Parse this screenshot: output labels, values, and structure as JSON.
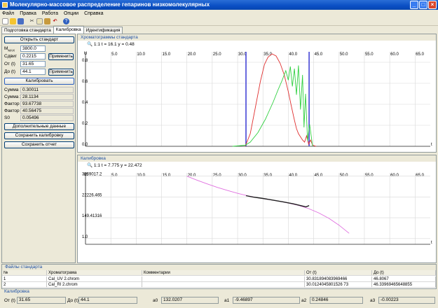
{
  "window": {
    "title": "Молекулярно-массовое распределение гепаринов низкомолекулярных",
    "buttons": [
      "_",
      "□",
      "×"
    ]
  },
  "menu": [
    "Файл",
    "Правка",
    "Работа",
    "Опции",
    "Справка"
  ],
  "toolbar_icons": [
    "new-icon",
    "open-icon",
    "save-icon",
    "cut-icon",
    "copy-icon",
    "paste-icon",
    "undo-icon",
    "help-icon"
  ],
  "tabs": [
    {
      "label": "Подготовка стандарта",
      "active": false
    },
    {
      "label": "Калибровка",
      "active": true
    },
    {
      "label": "Идентификация",
      "active": false
    }
  ],
  "left": {
    "open_standard": "Открыть стандарт",
    "mw_label": "M",
    "mw_sub": "MAX",
    "mw_value": "3800.0",
    "shift_label": "Сдвиг",
    "shift_value": "0.2215",
    "apply1": "Применить",
    "from_label": "От (t)",
    "from_value": "31.65",
    "to_label": "До (t)",
    "to_value": "44.1",
    "apply2": "Применить",
    "calibrate": "Калибровать",
    "stats": [
      {
        "label": "Сумма 1",
        "value": "0.30011"
      },
      {
        "label": "Сумма 2",
        "value": "28.1134"
      },
      {
        "label": "Фактор r",
        "value": "93.67738"
      },
      {
        "label": "Фактор f",
        "value": "40.56475"
      },
      {
        "label": "S0",
        "value": "0.05496"
      }
    ],
    "extra_data": "Дополнительные данные",
    "save_calibration": "Сохранить калибровку",
    "save_report": "Сохранить отчет"
  },
  "chart1": {
    "pane_title": "Хроматограммы стандарта",
    "toolbar_text": "1:1  t = 16.1  y = 0.48",
    "x_ticks": [
      "5.0",
      "10.0",
      "15.0",
      "20.0",
      "25.0",
      "30.0",
      "35.0",
      "40.0",
      "45.0",
      "50.0",
      "55.0",
      "60.0",
      "65.0"
    ],
    "y_ticks": [
      "0.8",
      "0.6",
      "0.4",
      "0.2",
      "0.0"
    ],
    "x_axis_label": "t",
    "y_axis_label": "U"
  },
  "chart2": {
    "pane_title": "Калибровка",
    "toolbar_text": "1:1  t = 7.775  y = 22.472",
    "x_ticks": [
      "5.0",
      "10.0",
      "15.0",
      "20.0",
      "25.0",
      "30.0",
      "35.0",
      "40.0",
      "45.0",
      "50.0",
      "55.0",
      "60.0",
      "65.0"
    ],
    "y_ticks": [
      "3269017.2",
      "22226.465",
      "149.41316",
      "1.0"
    ],
    "x_axis_label": "t",
    "y_axis_label": "M"
  },
  "chart_data": [
    {
      "type": "line",
      "title": "Хроматограммы стандарта",
      "xlabel": "t",
      "ylabel": "U",
      "xlim": [
        0,
        68
      ],
      "ylim": [
        0,
        0.9
      ],
      "vlines": [
        31.65,
        44.1
      ],
      "series": [
        {
          "color": "#e03030",
          "points": [
            [
              31.5,
              0.0
            ],
            [
              32.5,
              0.12
            ],
            [
              33.5,
              0.37
            ],
            [
              34.5,
              0.62
            ],
            [
              35.3,
              0.78
            ],
            [
              36.0,
              0.85
            ],
            [
              36.8,
              0.88
            ],
            [
              37.6,
              0.86
            ],
            [
              38.4,
              0.79
            ],
            [
              39.2,
              0.68
            ],
            [
              40.0,
              0.52
            ],
            [
              40.6,
              0.38
            ],
            [
              41.2,
              0.25
            ],
            [
              41.6,
              0.17
            ],
            [
              42.0,
              0.12
            ],
            [
              42.4,
              0.09
            ],
            [
              42.8,
              0.06
            ],
            [
              43.2,
              0.04
            ],
            [
              43.6,
              0.1
            ],
            [
              44.0,
              0.02
            ],
            [
              44.4,
              0.06
            ],
            [
              44.8,
              0.01
            ],
            [
              45.5,
              0.0
            ]
          ]
        },
        {
          "color": "#30d040",
          "points": [
            [
              29.0,
              0.0
            ],
            [
              31.5,
              0.01
            ],
            [
              32.5,
              0.04
            ],
            [
              34.0,
              0.13
            ],
            [
              35.5,
              0.26
            ],
            [
              37.0,
              0.42
            ],
            [
              38.0,
              0.54
            ],
            [
              38.8,
              0.63
            ],
            [
              39.5,
              0.72
            ],
            [
              40.0,
              0.63
            ],
            [
              40.4,
              0.76
            ],
            [
              40.8,
              0.57
            ],
            [
              41.2,
              0.74
            ],
            [
              41.6,
              0.49
            ],
            [
              42.0,
              0.77
            ],
            [
              42.4,
              0.35
            ],
            [
              42.8,
              0.68
            ],
            [
              43.1,
              0.18
            ],
            [
              43.4,
              0.5
            ],
            [
              43.8,
              0.05
            ],
            [
              44.2,
              0.21
            ],
            [
              44.8,
              0.0
            ]
          ]
        }
      ]
    },
    {
      "type": "line",
      "title": "Калибровка",
      "xlabel": "t",
      "ylabel": "M",
      "xlim": [
        0,
        68
      ],
      "y_scale": "log",
      "y_tick_labels": [
        "3269017.2",
        "22226.465",
        "149.41316",
        "1.0"
      ],
      "series": [
        {
          "color": "#e070e0",
          "points": [
            [
              20.0,
              3269017.2
            ],
            [
              22.0,
              1240000
            ],
            [
              24.0,
              510000
            ],
            [
              26.0,
              222000
            ],
            [
              28.0,
              105000
            ],
            [
              30.0,
              53000
            ],
            [
              32.0,
              29000
            ],
            [
              34.0,
              18000
            ],
            [
              36.0,
              12200
            ],
            [
              38.0,
              8200
            ],
            [
              40.0,
              5200
            ],
            [
              42.0,
              2900
            ],
            [
              44.0,
              1350
            ],
            [
              46.0,
              480
            ],
            [
              48.0,
              130
            ],
            [
              50.0,
              25
            ],
            [
              52.0,
              3.5
            ]
          ]
        },
        {
          "color": "#202020",
          "points": [
            [
              31.65,
              30000
            ],
            [
              33.0,
              22000
            ],
            [
              35.0,
              15400
            ],
            [
              37.0,
              10200
            ],
            [
              39.0,
              6700
            ],
            [
              41.0,
              4200
            ],
            [
              42.5,
              2700
            ],
            [
              43.5,
              2050
            ],
            [
              44.1,
              2800
            ]
          ]
        }
      ]
    }
  ],
  "files": {
    "title": "Файлы стандарта",
    "headers": [
      "№",
      "Хроматограма",
      "Комментарии",
      "От (t)",
      "До (t)"
    ],
    "rows": [
      [
        "1",
        "Cal_UV 2.chrom",
        "",
        "30.831894083969466",
        "46.8067"
      ],
      [
        "2",
        "Cal_RI 2.chrom",
        "",
        "30.0124045801526 73",
        "46.33969465648855"
      ]
    ]
  },
  "bottom": {
    "title": "Калибровка",
    "from_label": "От (t)",
    "from_value": "31.65",
    "to_label": "До (t)",
    "to_value": "44.1",
    "a0_label": "a0",
    "a0_value": "132.0207",
    "a1_label": "a1",
    "a1_value": "-9.46897",
    "a2_label": "a2",
    "a2_value": "0.24846",
    "a3_label": "a3",
    "a3_value": "-0.00223"
  }
}
